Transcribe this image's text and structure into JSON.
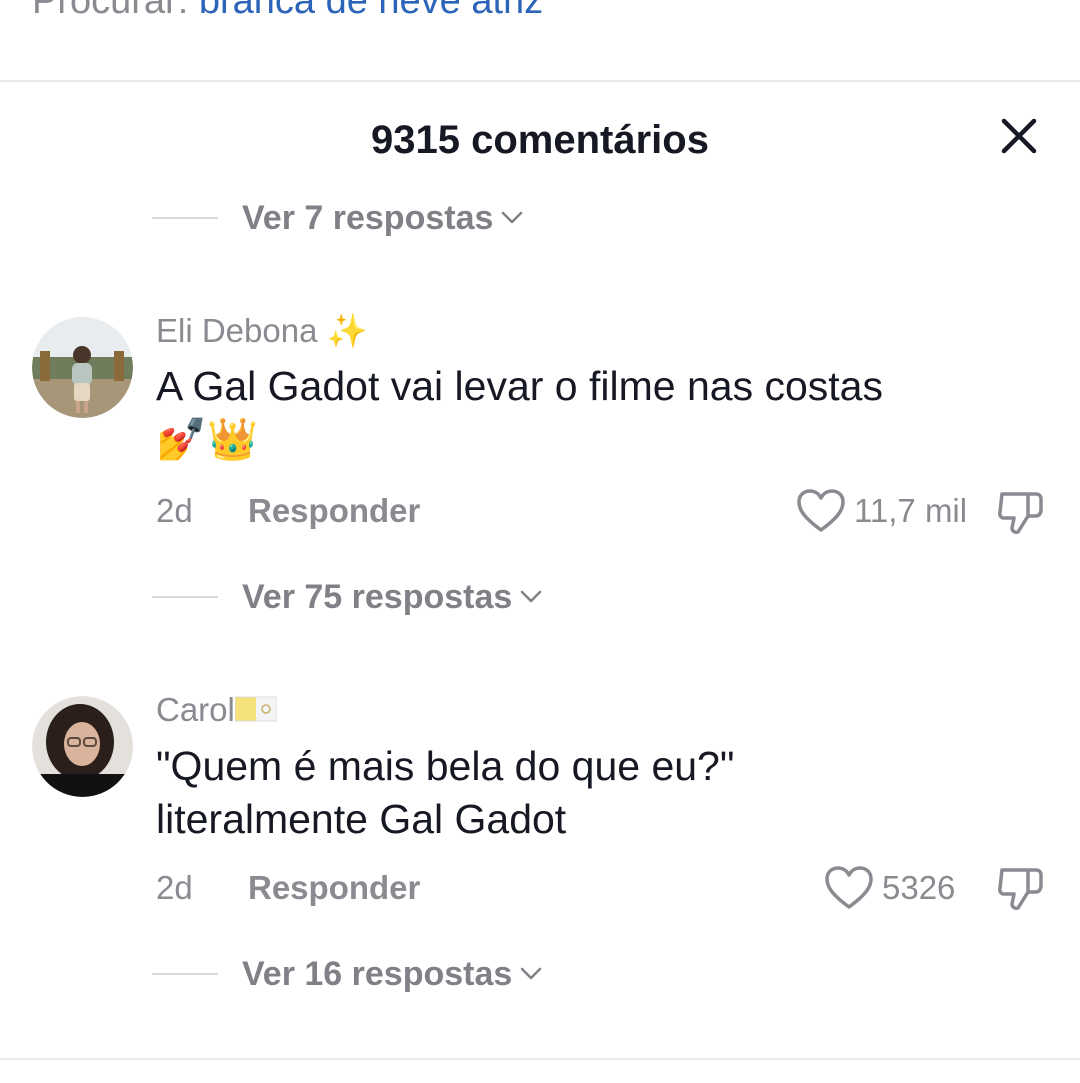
{
  "search": {
    "prefix": "Procurar:",
    "query": "branca de neve atriz"
  },
  "header": {
    "title": "9315 comentários",
    "close_icon": "close-icon"
  },
  "replies_top": {
    "label": "Ver 7 respostas"
  },
  "comments": [
    {
      "username": "Eli Debona",
      "user_emoji": "✨",
      "text": "A Gal Gadot vai levar o filme nas costas",
      "text_emojis": "💅👑",
      "date": "2d",
      "reply_label": "Responder",
      "likes": "11,7 mil",
      "replies_label": "Ver 75 respostas"
    },
    {
      "username": "Carol",
      "user_emoji": "flag-icon",
      "text_line1": "\"Quem é mais bela do que eu?\"",
      "text_line2": "literalmente Gal Gadot",
      "date": "2d",
      "reply_label": "Responder",
      "likes": "5326",
      "replies_label": "Ver 16 respostas"
    }
  ],
  "colors": {
    "text_primary": "#161823",
    "text_secondary": "#8a8b91",
    "link_blue": "#2b64b8",
    "divider": "#e9e9ea"
  }
}
